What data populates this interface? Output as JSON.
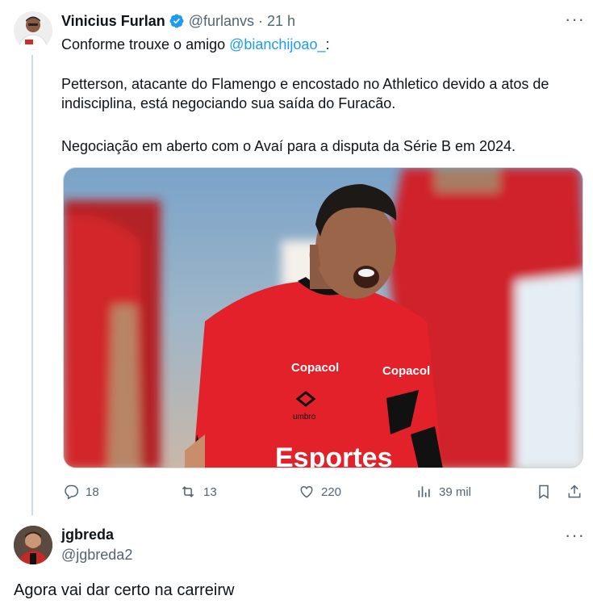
{
  "tweet": {
    "author_name": "Vinicius Furlan",
    "author_handle": "@furlanvs",
    "separator": "·",
    "time": "21 h",
    "lines": {
      "intro_prefix": "Conforme trouxe o amigo ",
      "intro_mention": "@bianchijoao_",
      "intro_suffix": ":",
      "para1": "Petterson, atacante do Flamengo e encostado no Athletico devido a atos de indisciplina, está negociando sua saída do Furacão.",
      "para2": "Negociação em aberto com o Avaí para a disputa da Série B em 2024."
    },
    "media": {
      "jersey_sponsor_left": "Copacol",
      "jersey_sponsor_right": "Copacol",
      "jersey_brand": "umbro",
      "jersey_front": "Esportes"
    },
    "stats": {
      "replies": "18",
      "retweets": "13",
      "likes": "220",
      "views": "39 mil"
    },
    "icons": [
      "verified-icon",
      "more-icon",
      "reply-icon",
      "retweet-icon",
      "like-icon",
      "views-icon",
      "bookmark-icon",
      "share-icon"
    ],
    "colors": {
      "accent": "#1d9bf0",
      "jersey_red": "#e2212a",
      "jersey_black": "#111111"
    }
  },
  "reply": {
    "author_name": "jgbreda",
    "author_handle": "@jgbreda2",
    "text": "Agora vai dar certo na carreirw"
  }
}
